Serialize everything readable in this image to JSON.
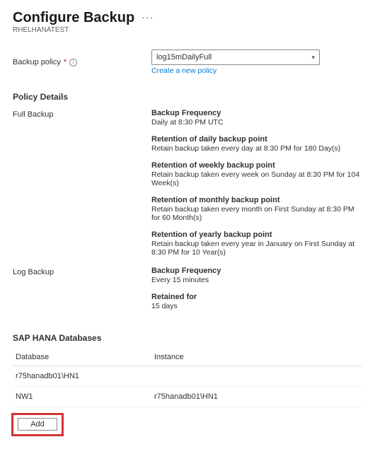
{
  "header": {
    "title": "Configure Backup",
    "subtitle": "RHELHANATEST"
  },
  "policy_field": {
    "label": "Backup policy",
    "required_marker": "*",
    "selected": "log15mDailyFull",
    "create_link": "Create a new policy"
  },
  "policy_details": {
    "section_title": "Policy Details",
    "groups": [
      {
        "name": "Full Backup",
        "items": [
          {
            "title": "Backup Frequency",
            "sub": "Daily at 8:30 PM UTC"
          },
          {
            "title": "Retention of daily backup point",
            "sub": "Retain backup taken every day at 8:30 PM for 180 Day(s)"
          },
          {
            "title": "Retention of weekly backup point",
            "sub": "Retain backup taken every week on Sunday at 8:30 PM for 104 Week(s)"
          },
          {
            "title": "Retention of monthly backup point",
            "sub": "Retain backup taken every month on First Sunday at 8:30 PM for 60 Month(s)"
          },
          {
            "title": "Retention of yearly backup point",
            "sub": "Retain backup taken every year in January on First Sunday at 8:30 PM for 10 Year(s)"
          }
        ]
      },
      {
        "name": "Log Backup",
        "items": [
          {
            "title": "Backup Frequency",
            "sub": "Every 15 minutes"
          },
          {
            "title": "Retained for",
            "sub": "15 days"
          }
        ]
      }
    ]
  },
  "databases": {
    "section_title": "SAP HANA Databases",
    "columns": {
      "db": "Database",
      "instance": "Instance"
    },
    "rows": [
      {
        "db": "r75hanadb01\\HN1",
        "instance": ""
      },
      {
        "db": "NW1",
        "instance": "r75hanadb01\\HN1"
      }
    ],
    "add_label": "Add"
  }
}
